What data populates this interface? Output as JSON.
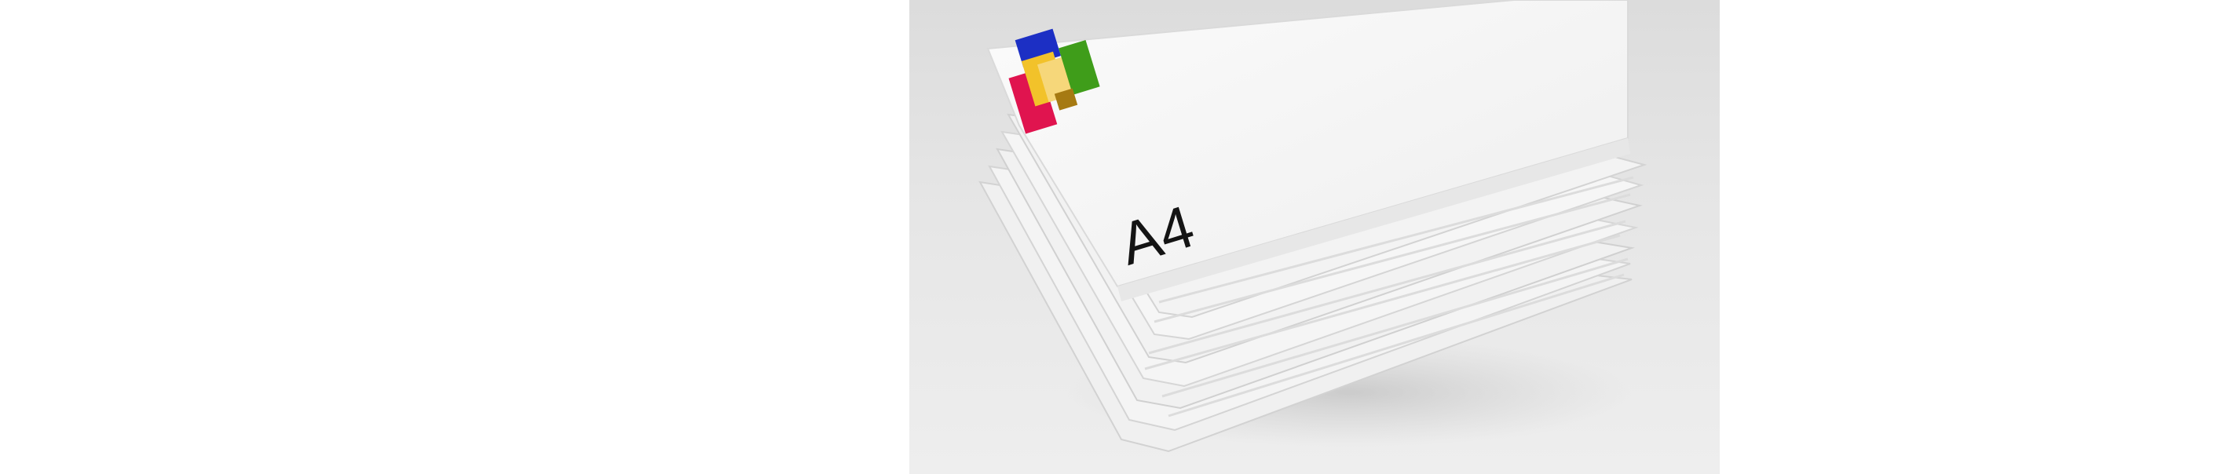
{
  "image": {
    "description_label": "A4",
    "logo_colors": [
      "#1c2fc4",
      "#e0144f",
      "#f2c22a",
      "#f6d77a",
      "#3f9d1a",
      "#a67a12"
    ],
    "paper_color": "#f6f6f6",
    "backdrop_color": "#e2e2e2"
  }
}
